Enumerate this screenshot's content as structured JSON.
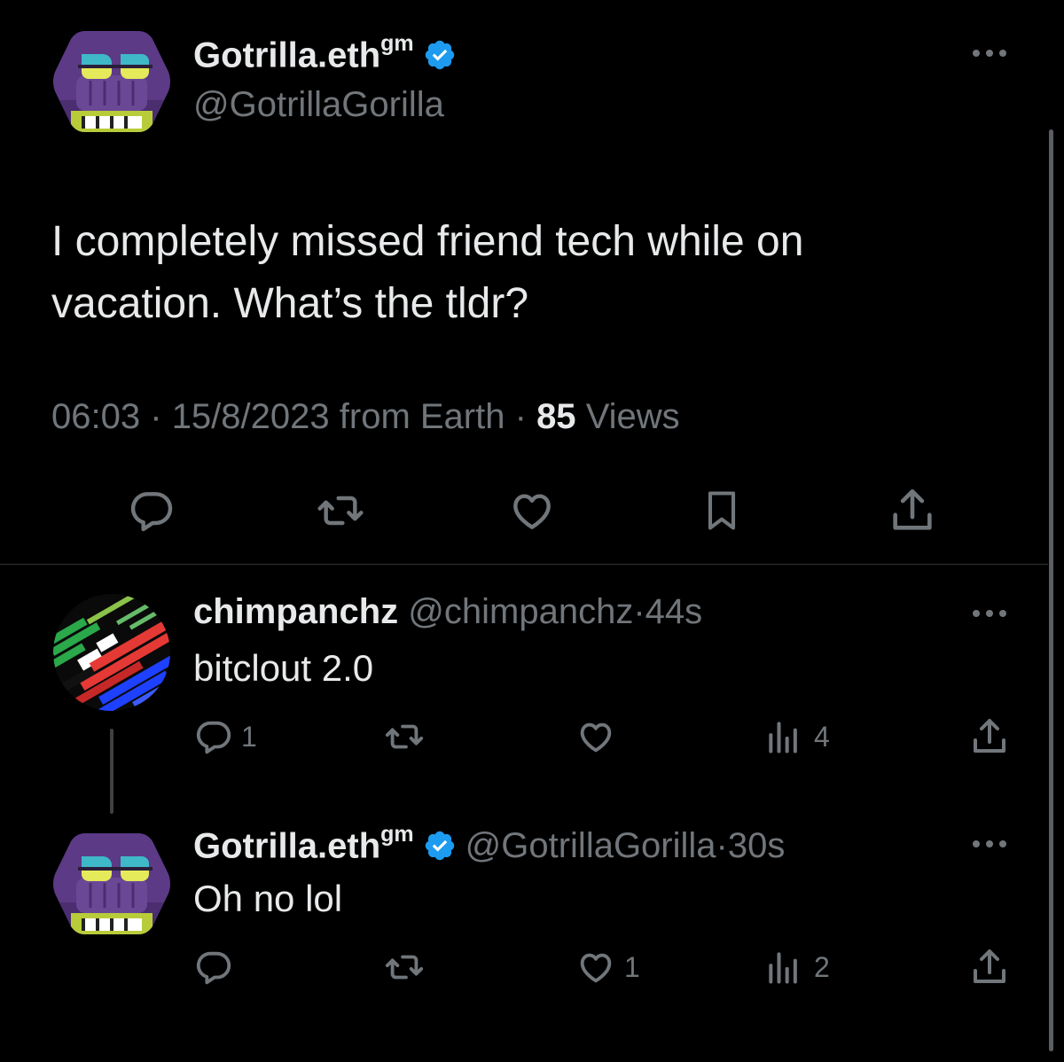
{
  "main_tweet": {
    "display_name": "Gotrilla.eth",
    "name_suffix": "gm",
    "handle": "@GotrillaGorilla",
    "text_line1": "I completely missed friend tech while on",
    "text_line2": "vacation. What’s the tldr?",
    "time": "06:03",
    "date": "15/8/2023",
    "source": "from Earth",
    "views_count": "85",
    "views_label": "Views"
  },
  "replies": [
    {
      "display_name": "chimpanchz",
      "handle": "@chimpanchz",
      "age": "44s",
      "text": "bitclout 2.0",
      "reply_count": "1",
      "like_count": "",
      "view_count": "4"
    },
    {
      "display_name": "Gotrilla.eth",
      "name_suffix": "gm",
      "handle": "@GotrillaGorilla",
      "age": "30s",
      "text": "Oh no lol",
      "reply_count": "",
      "like_count": "1",
      "view_count": "2"
    }
  ],
  "separator": "·",
  "colors": {
    "background": "#000000",
    "text": "#e7e9ea",
    "muted": "#71767b",
    "verified": "#1d9bf0",
    "divider": "#2f3336"
  },
  "icons": [
    "reply-icon",
    "retweet-icon",
    "like-icon",
    "bookmark-icon",
    "share-icon",
    "views-icon",
    "more-icon",
    "verified-badge-icon"
  ]
}
